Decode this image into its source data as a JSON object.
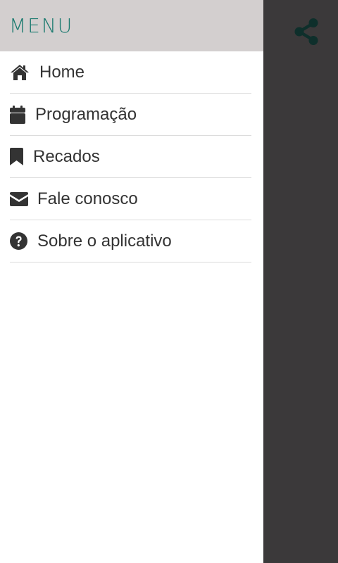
{
  "drawer": {
    "title": "MENU",
    "items": [
      {
        "label": "Home",
        "icon": "home-icon"
      },
      {
        "label": "Programação",
        "icon": "calendar-icon"
      },
      {
        "label": "Recados",
        "icon": "bookmark-icon"
      },
      {
        "label": "Fale conosco",
        "icon": "envelope-icon"
      },
      {
        "label": "Sobre o aplicativo",
        "icon": "question-circle-icon"
      }
    ]
  },
  "toolbar": {
    "share_icon": "share-icon"
  },
  "colors": {
    "header_bg": "#d3cfcf",
    "title_color": "#1b7a6f",
    "backdrop": "#3b393a",
    "share_icon_color": "#0e2f2b",
    "text": "#333333"
  }
}
